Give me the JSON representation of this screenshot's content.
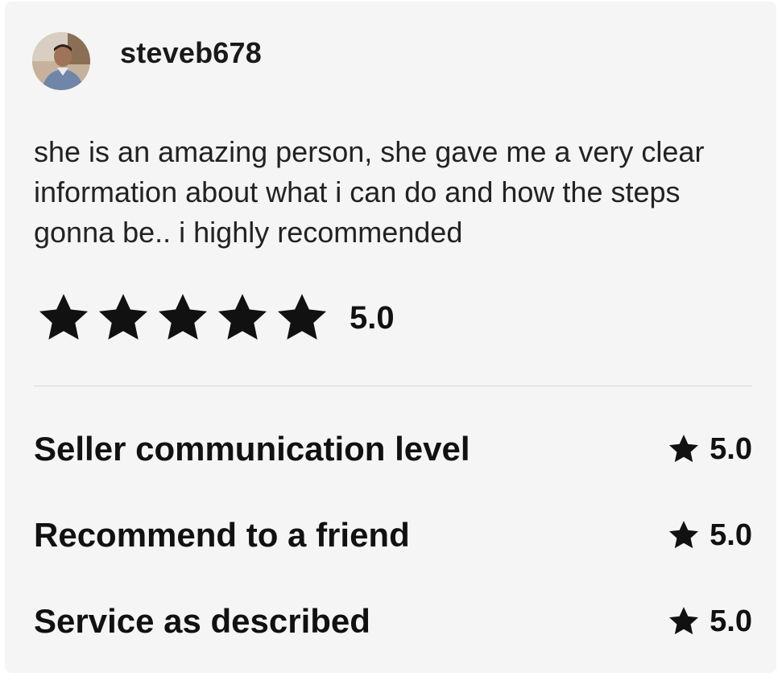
{
  "review": {
    "username": "steveb678",
    "text": "she is an amazing person, she gave me a very clear information about what i can do and how the steps gonna be.. i highly recommended",
    "rating": "5.0",
    "stars_filled": 5,
    "stars_total": 5
  },
  "breakdown": [
    {
      "label": "Seller communication level",
      "value": "5.0"
    },
    {
      "label": "Recommend to a friend",
      "value": "5.0"
    },
    {
      "label": "Service as described",
      "value": "5.0"
    }
  ],
  "colors": {
    "card_background": "#f5f5f5",
    "star_fill": "#111111",
    "text": "#111111",
    "divider": "#d6d6d6"
  },
  "icons": {
    "avatar": "user-avatar",
    "star": "star-icon"
  }
}
